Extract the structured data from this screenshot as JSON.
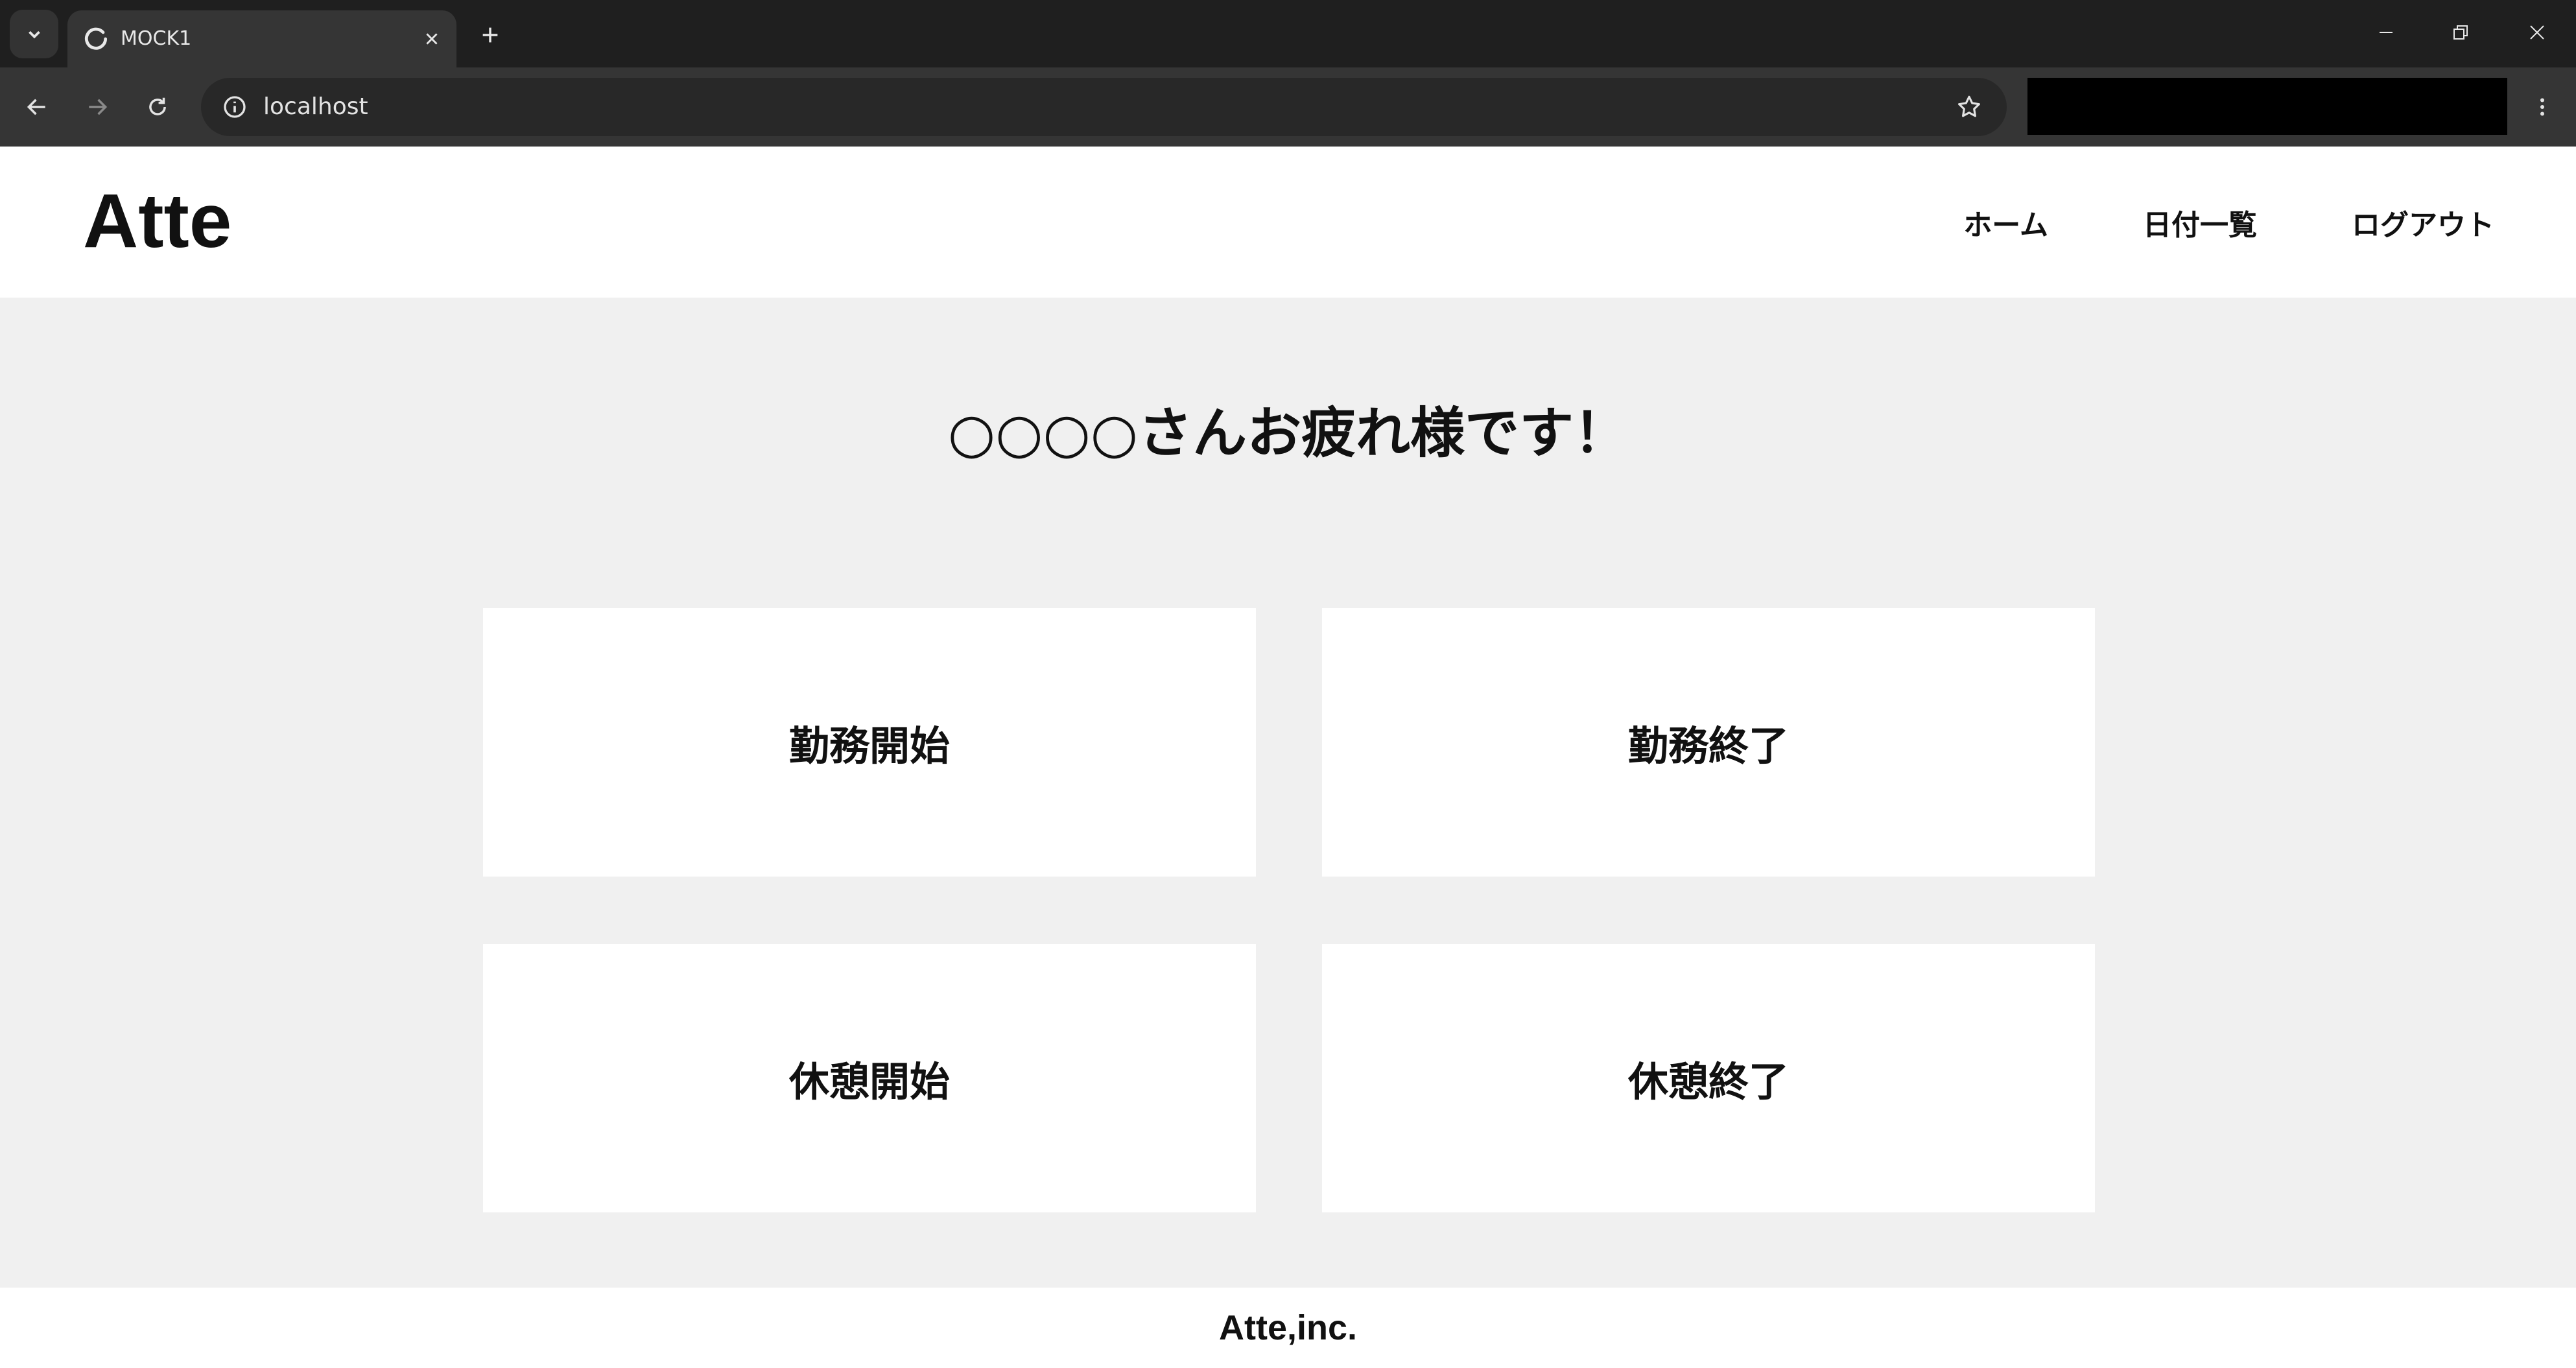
{
  "browser": {
    "tab_title": "MOCK1",
    "url": "localhost",
    "icons": {
      "tab_search": "chevron-down-icon",
      "favicon": "loading-spinner-icon",
      "tab_close": "close-icon",
      "new_tab": "plus-icon",
      "back": "arrow-left-icon",
      "forward": "arrow-right-icon",
      "reload": "reload-icon",
      "site_info": "info-icon",
      "bookmark": "star-icon",
      "menu": "kebab-menu-icon",
      "minimize": "minimize-icon",
      "restore": "restore-icon",
      "close_window": "close-icon"
    }
  },
  "header": {
    "logo": "Atte",
    "nav": [
      "ホーム",
      "日付一覧",
      "ログアウト"
    ]
  },
  "main": {
    "greeting": "○○○○さんお疲れ様です！",
    "buttons": {
      "work_start": "勤務開始",
      "work_end": "勤務終了",
      "break_start": "休憩開始",
      "break_end": "休憩終了"
    }
  },
  "footer": {
    "text": "Atte,inc."
  },
  "colors": {
    "page_bg": "#f0f0f0",
    "card_bg": "#ffffff",
    "text": "#111111",
    "chrome_bg": "#1f1f1f"
  }
}
